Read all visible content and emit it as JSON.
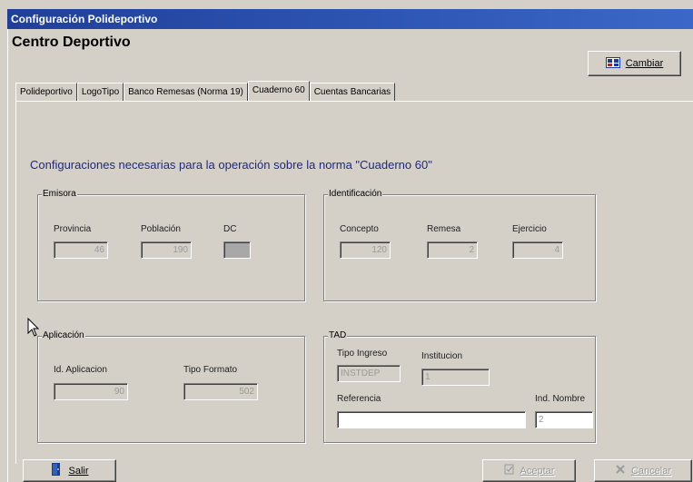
{
  "window": {
    "title": "Configuración Polideportivo"
  },
  "header": {
    "title": "Centro Deportivo",
    "change_label": "Cambiar"
  },
  "tabs": [
    {
      "label": "Polideportivo"
    },
    {
      "label": "LogoTipo"
    },
    {
      "label": "Banco Remesas (Norma 19)"
    },
    {
      "label": "Cuaderno 60"
    },
    {
      "label": "Cuentas Bancarias"
    }
  ],
  "active_tab": "Cuaderno 60",
  "main": {
    "subtitle": "Configuraciones necesarias para la operación sobre la norma \"Cuaderno 60\"",
    "emisora": {
      "label": "Emisora",
      "provincia_label": "Provincia",
      "provincia_value": "46",
      "poblacion_label": "Población",
      "poblacion_value": "190",
      "dc_label": "DC",
      "dc_value": ""
    },
    "identificacion": {
      "label": "Identificación",
      "concepto_label": "Concepto",
      "concepto_value": "120",
      "remesa_label": "Remesa",
      "remesa_value": "2",
      "ejercicio_label": "Ejercicio",
      "ejercicio_value": "4"
    },
    "aplicacion": {
      "label": "Aplicación",
      "id_label": "Id. Aplicacion",
      "id_value": "90",
      "formato_label": "Tipo Formato",
      "formato_value": "502"
    },
    "tad": {
      "label": "TAD",
      "tipo_ingreso_label": "Tipo Ingreso",
      "tipo_ingreso_value": "INSTDEP",
      "institucion_label": "Institucion",
      "institucion_value": "1",
      "referencia_label": "Referencia",
      "referencia_value": "",
      "ind_nombre_label": "Ind. Nombre",
      "ind_nombre_value": "2"
    }
  },
  "footer": {
    "exit_label": "Salir",
    "accept_label": "Aceptar",
    "cancel_label": "Cancelar"
  }
}
